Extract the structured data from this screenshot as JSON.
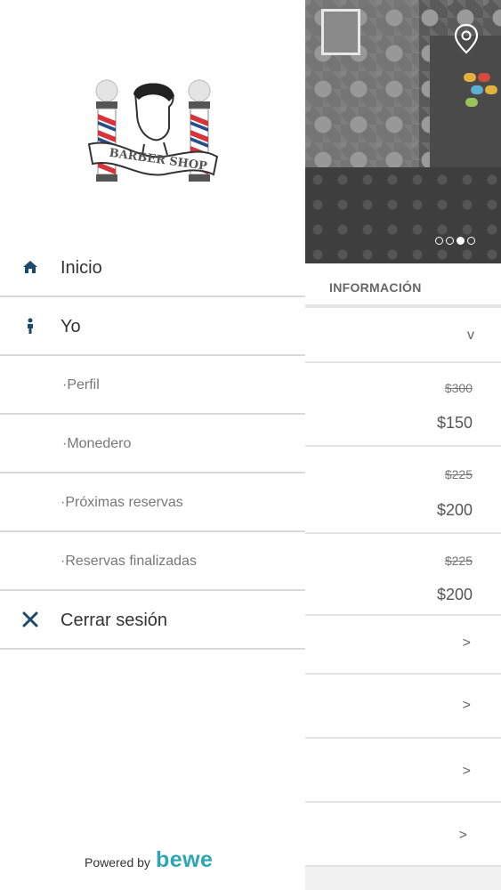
{
  "drawer": {
    "menu": [
      {
        "label": "Inicio",
        "icon": "home-icon"
      },
      {
        "label": "Yo",
        "icon": "person-icon"
      },
      {
        "label": "·Perfil"
      },
      {
        "label": "·Monedero"
      },
      {
        "label": "·Próximas reservas"
      },
      {
        "label": "·Reservas finalizadas"
      },
      {
        "label": "Cerrar sesión",
        "icon": "close-icon"
      }
    ],
    "logo_text": "BARBER SHOP",
    "powered_by": "Powered by",
    "brand": "bewe"
  },
  "background": {
    "info_tab": "INFORMACIÓN",
    "services": [
      {
        "old_price": "$300",
        "new_price": "$150"
      },
      {
        "old_price": "$225",
        "new_price": "$200"
      },
      {
        "old_price": "$225",
        "new_price": "$200"
      }
    ],
    "carousel": {
      "count": 4,
      "active": 2
    }
  },
  "colors": {
    "icon_navy": "#1d4a6b",
    "brand_teal": "#2aa6b7",
    "pole_red": "#d6333a",
    "pole_blue": "#2a4e8c"
  }
}
